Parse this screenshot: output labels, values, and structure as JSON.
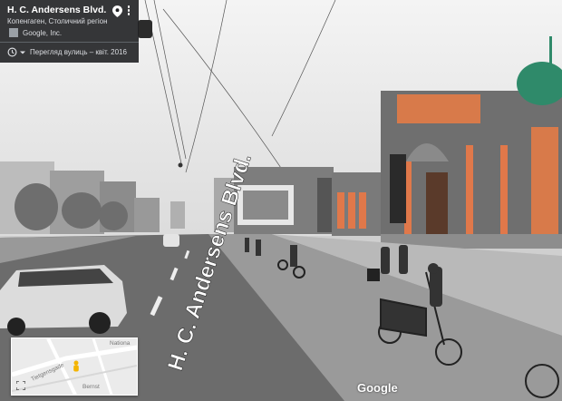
{
  "info_card": {
    "title": "H. C. Andersens Blvd.",
    "subtitle": "Копенгаген, Столичний регіон",
    "attribution": "Google, Inc.",
    "capture_date": "Перегляд вулиць – квіт. 2016"
  },
  "minimap": {
    "labels": [
      "Nationa",
      "Tietgensgade",
      "Bernst"
    ]
  },
  "road_label": "H. C. Andersens Blvd.",
  "watermark": "Google",
  "colors": {
    "card_bg": "#202124",
    "facade_accent": "#e0784a",
    "dome": "#2f8a6a",
    "pegman": "#f4b400"
  },
  "icons": [
    "map-pin-icon",
    "more-vert-icon",
    "camera-icon",
    "history-icon",
    "chevron-down-icon",
    "expand-icon",
    "pegman-icon"
  ]
}
